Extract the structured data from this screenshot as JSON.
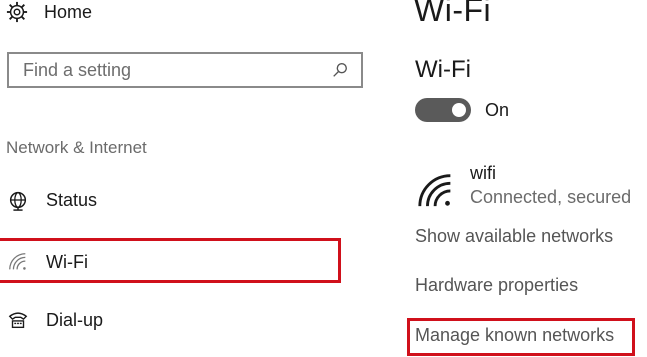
{
  "sidebar": {
    "home_label": "Home",
    "home_icon": "gear-icon",
    "search_placeholder": "Find a setting",
    "search_icon": "search-icon",
    "section_title": "Network & Internet",
    "items": [
      {
        "label": "Status",
        "icon": "globe-icon"
      },
      {
        "label": "Wi-Fi",
        "icon": "wifi-icon",
        "highlighted": true
      },
      {
        "label": "Dial-up",
        "icon": "dialup-icon"
      }
    ]
  },
  "main": {
    "title": "Wi-Fi",
    "subtitle": "Wi-Fi",
    "toggle": {
      "state_label": "On",
      "on": true
    },
    "network": {
      "name": "wifi",
      "status": "Connected, secured",
      "icon": "wifi-signal-icon"
    },
    "links": {
      "show_available": "Show available networks",
      "hardware": "Hardware properties",
      "manage_known": "Manage known networks"
    }
  },
  "colors": {
    "highlight": "#d0101b",
    "toggle_on": "#5a5a5a",
    "muted_text": "#6b6b6b"
  }
}
